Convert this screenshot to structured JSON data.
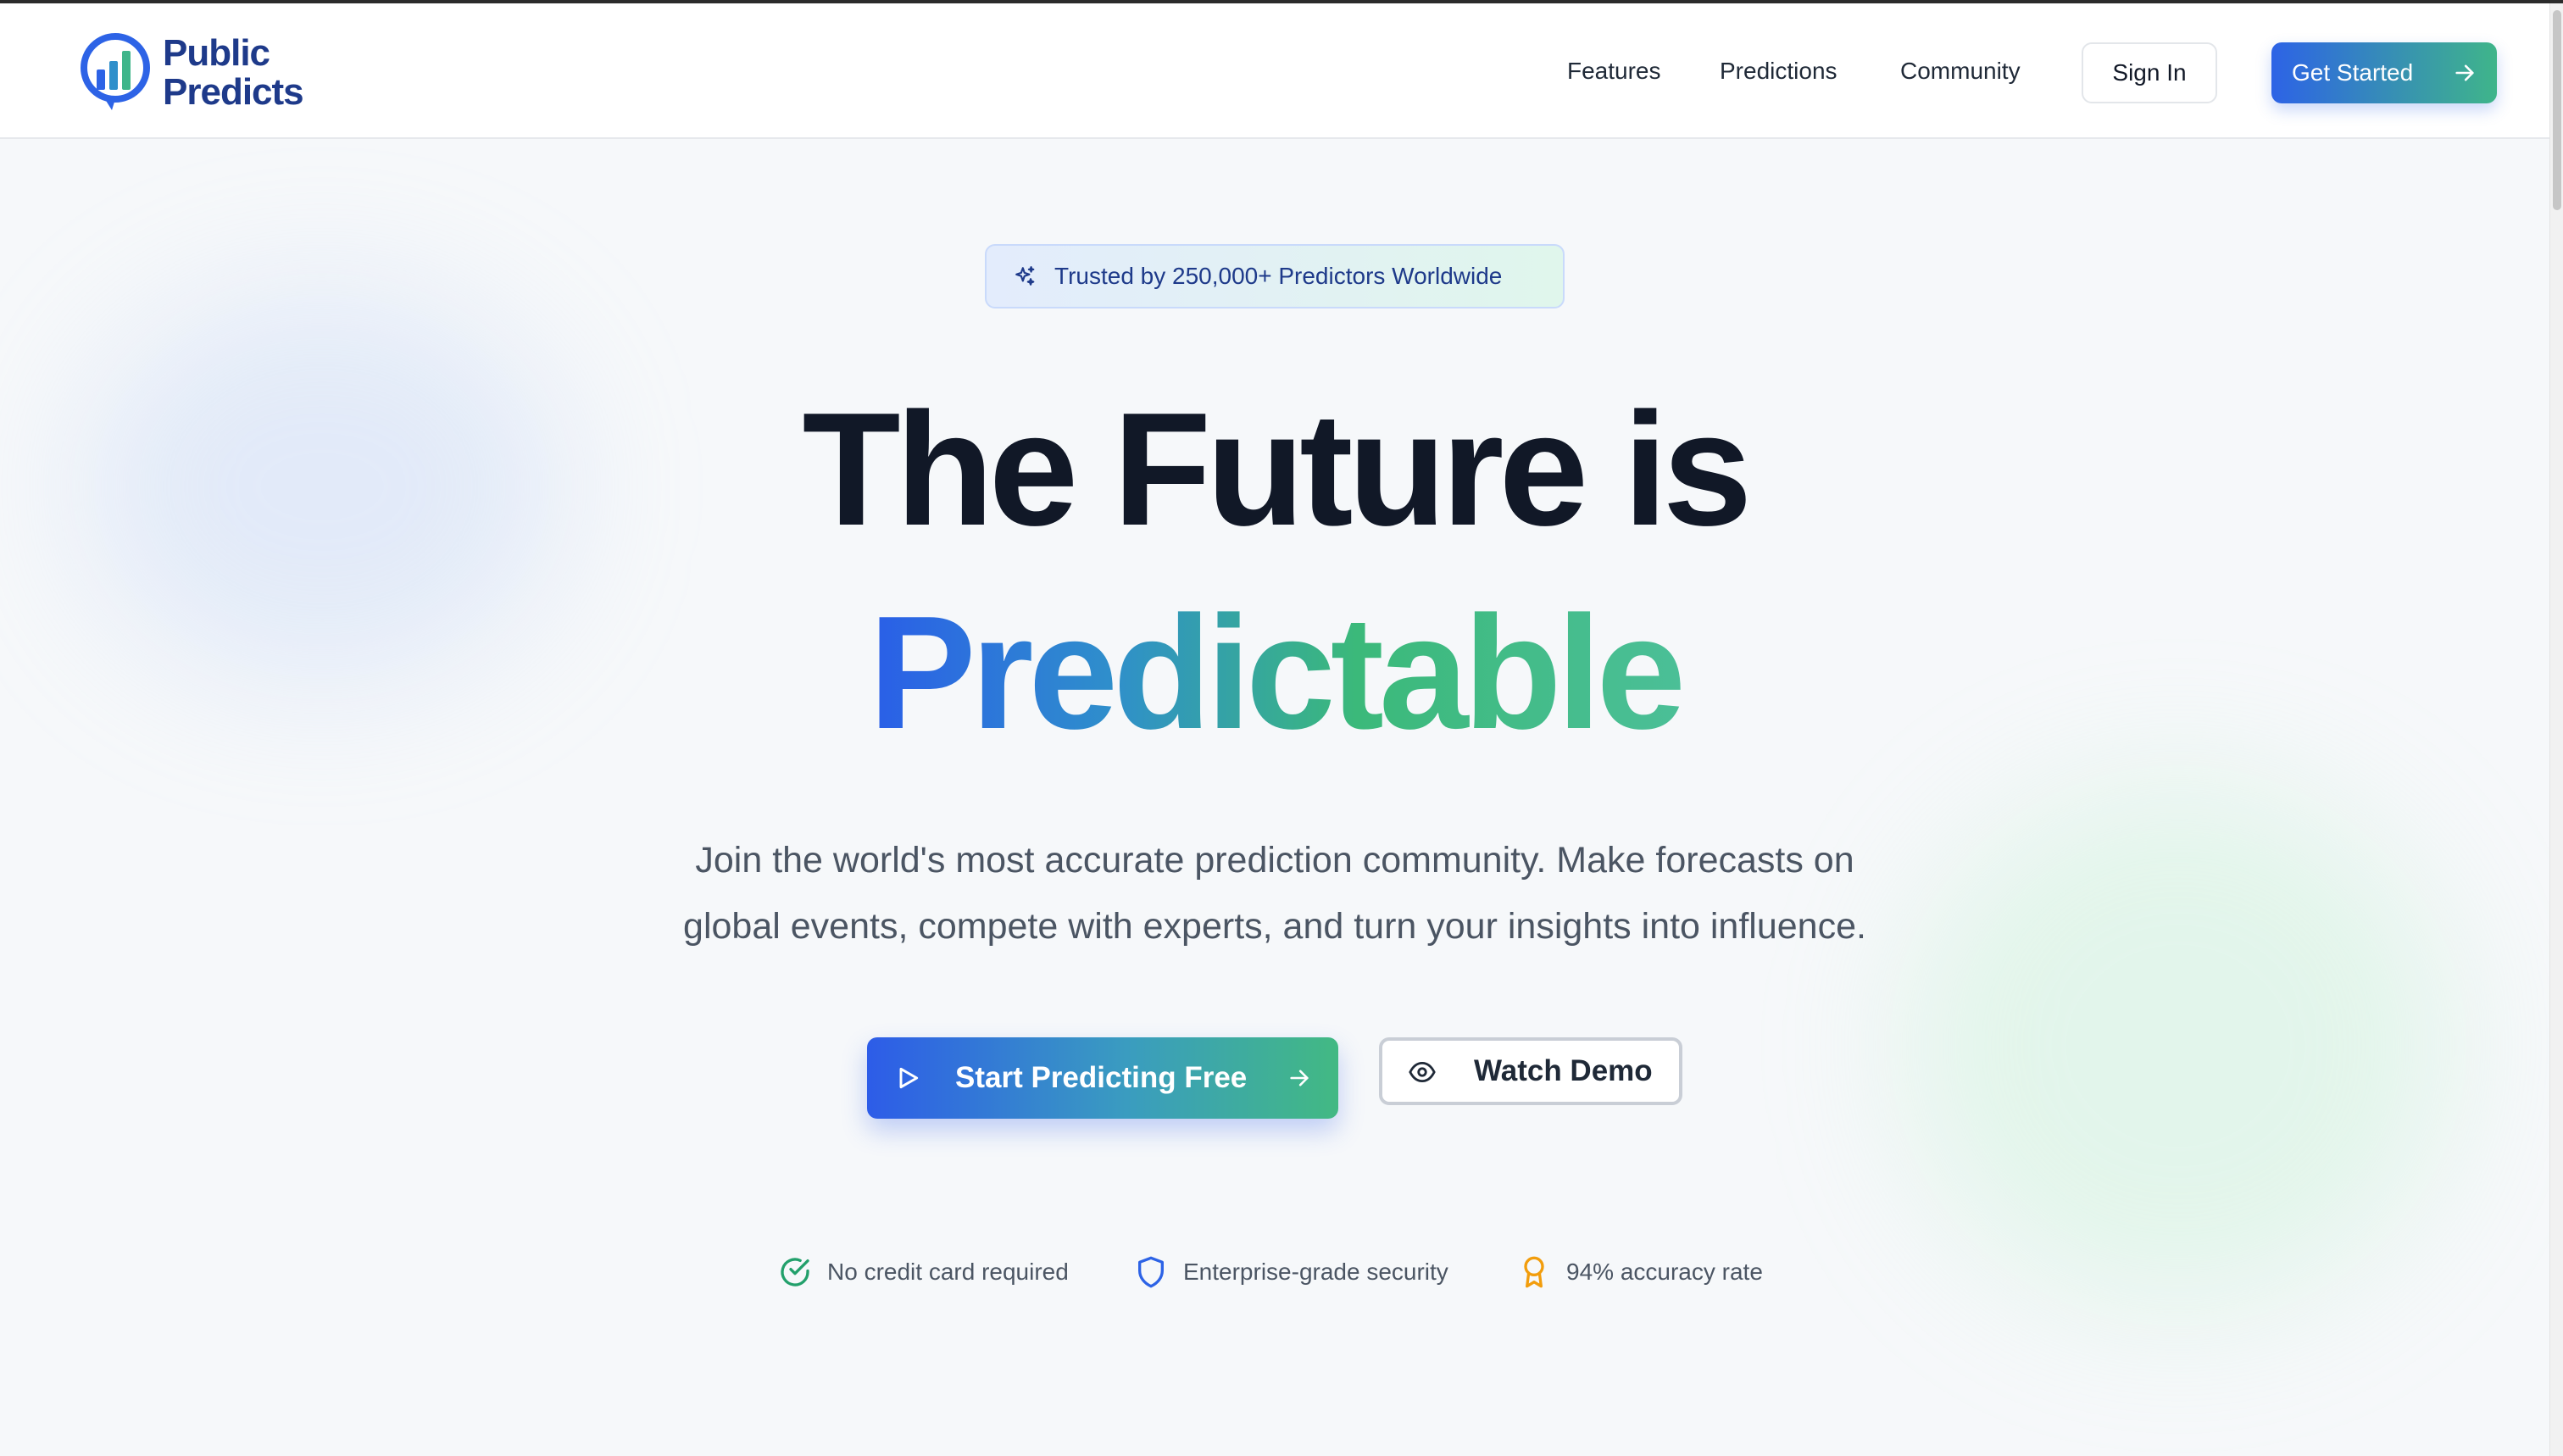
{
  "brand": {
    "line1": "Public",
    "line2": "Predicts"
  },
  "nav": {
    "features": "Features",
    "predictions": "Predictions",
    "community": "Community",
    "sign_in": "Sign In",
    "get_started": "Get Started"
  },
  "hero": {
    "badge": "Trusted by 250,000+ Predictors Worldwide",
    "headline_line1": "The Future is",
    "headline_line2": "Predictable",
    "subtitle_line1": "Join the world's most accurate prediction community. Make forecasts on",
    "subtitle_line2": "global events, compete with experts, and turn your insights into influence.",
    "cta_primary": "Start Predicting Free",
    "cta_secondary": "Watch Demo"
  },
  "trust": [
    {
      "label": "No credit card required",
      "icon": "check-circle-icon",
      "color": "#22a06b"
    },
    {
      "label": "Enterprise-grade security",
      "icon": "shield-icon",
      "color": "#2d63e6"
    },
    {
      "label": "94% accuracy rate",
      "icon": "award-icon",
      "color": "#f29d0c"
    }
  ],
  "colors": {
    "brand_blue": "#2d63e6",
    "brand_green": "#3fb58a",
    "navy": "#1e3a8a"
  }
}
